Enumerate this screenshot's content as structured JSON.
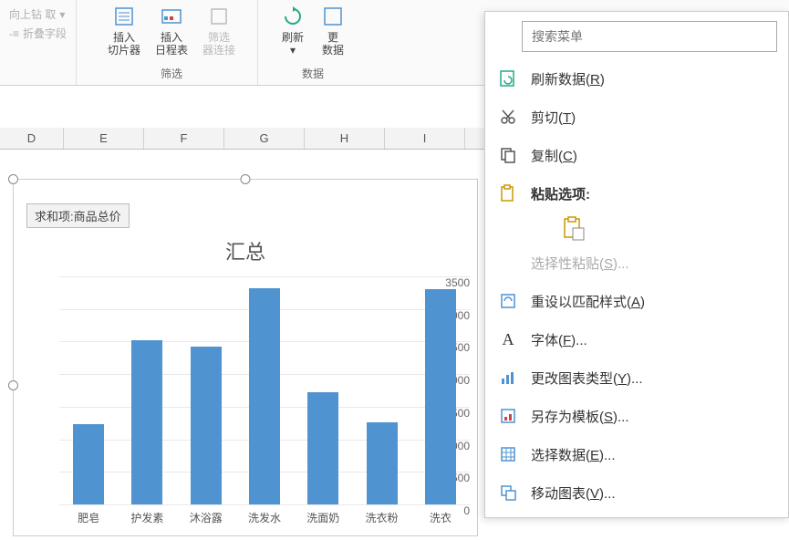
{
  "ribbon": {
    "group_drill": {
      "up_label": "向上钻\n取",
      "collapse_label": "折叠字段"
    },
    "group_filter": {
      "slicer_label": "插入\n切片器",
      "timeline_label": "插入\n日程表",
      "filterconn_label": "筛选\n器连接",
      "title": "筛选"
    },
    "group_data": {
      "refresh_label": "刷新",
      "change_label": "更\n数据",
      "title": "数据"
    }
  },
  "columns": [
    "D",
    "E",
    "F",
    "G",
    "H",
    "I"
  ],
  "chart_data": {
    "type": "bar",
    "legend_box": "求和项:商品总价",
    "title": "汇总",
    "categories": [
      "肥皂",
      "护发素",
      "沐浴露",
      "洗发水",
      "洗面奶",
      "洗衣粉",
      "洗衣"
    ],
    "values": [
      1230,
      2520,
      2420,
      3320,
      1720,
      1260,
      3300
    ],
    "ylim": [
      0,
      3500
    ],
    "ystep": 500,
    "yticks": [
      0,
      500,
      1000,
      1500,
      2000,
      2500,
      3000,
      3500
    ]
  },
  "context_menu": {
    "search_placeholder": "搜索菜单",
    "items": {
      "refresh": "刷新数据(R)",
      "cut": "剪切(T)",
      "copy": "复制(C)",
      "paste_header": "粘贴选项:",
      "paste_special": "选择性粘贴(S)...",
      "reset_style": "重设以匹配样式(A)",
      "font": "字体(F)...",
      "change_type": "更改图表类型(Y)...",
      "save_template": "另存为模板(S)...",
      "select_data": "选择数据(E)...",
      "move_chart": "移动图表(V)..."
    }
  }
}
